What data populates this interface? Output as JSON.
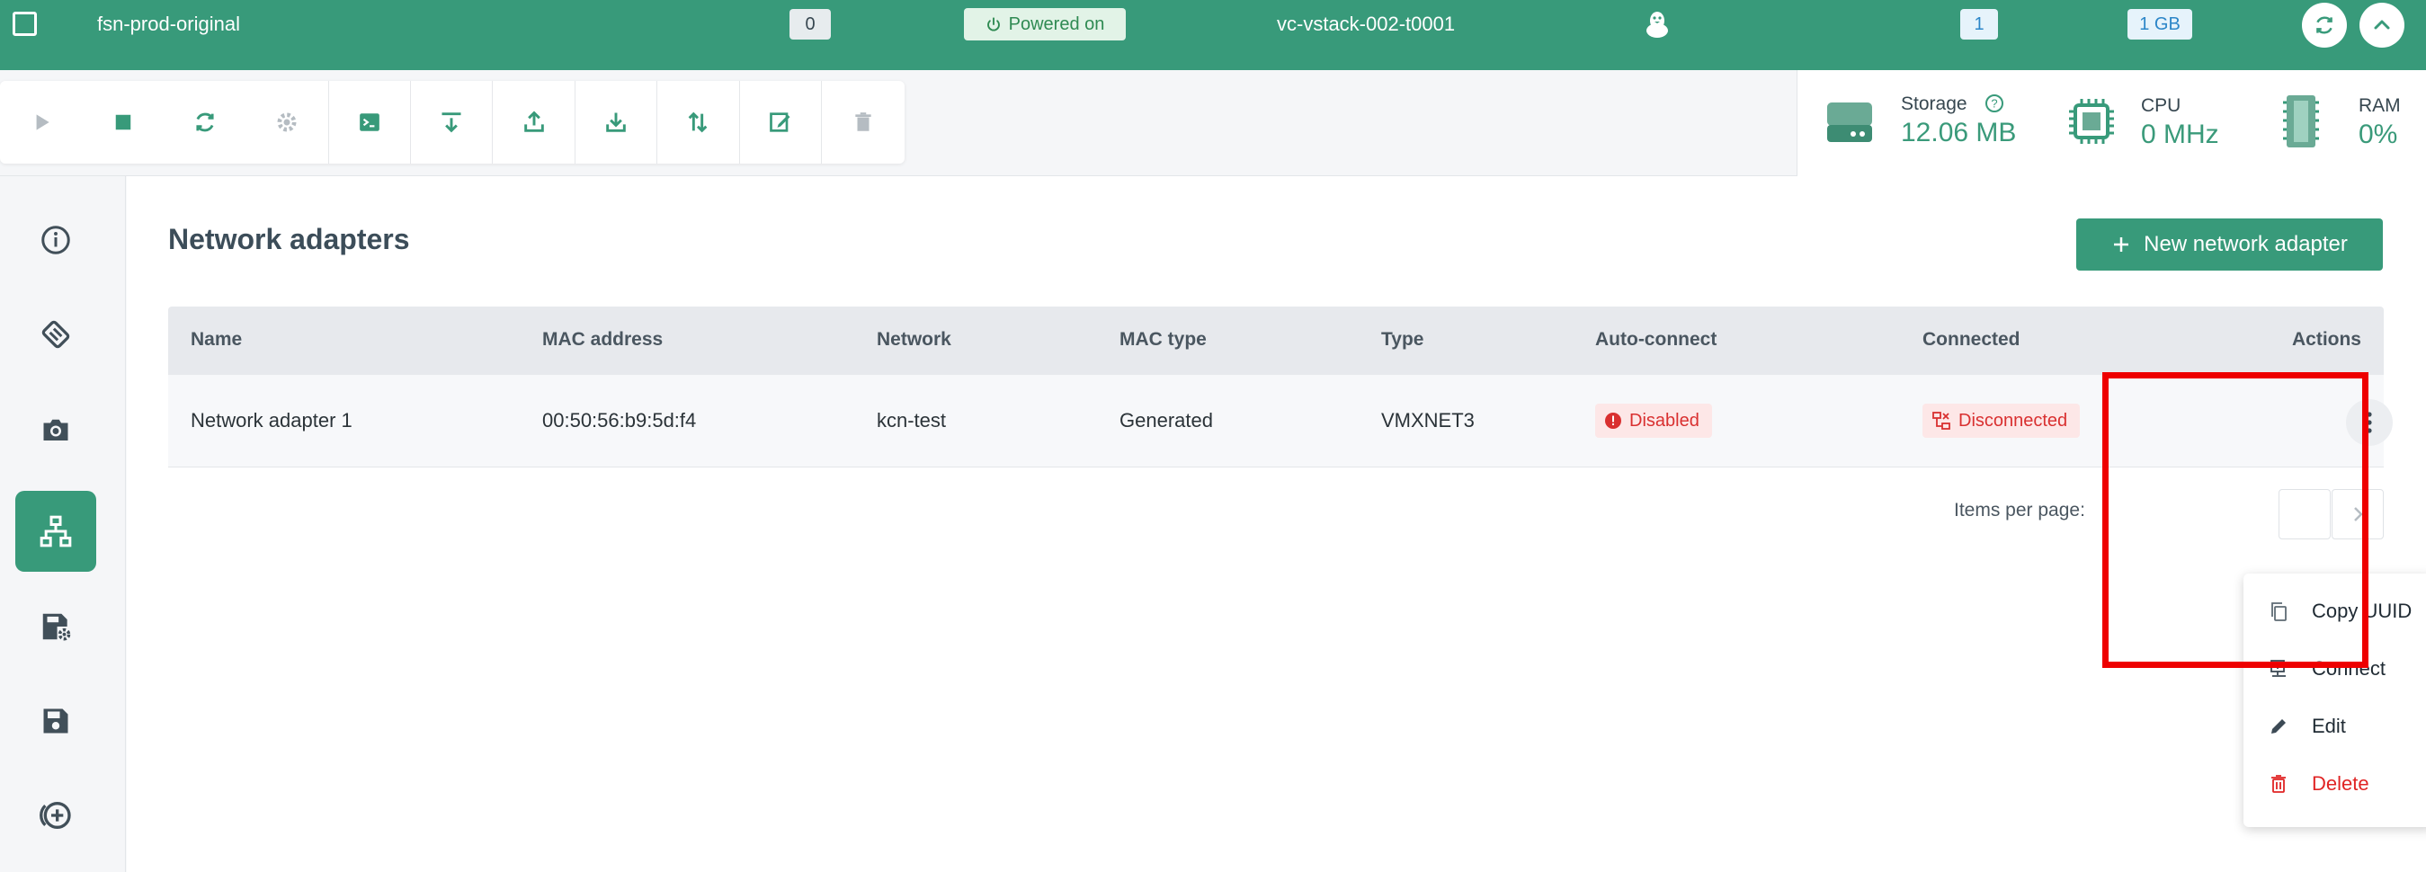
{
  "topbar": {
    "vm_name": "fsn-prod-original",
    "count": "0",
    "power_status": "Powered on",
    "host": "vc-vstack-002-t0001",
    "cpu_count": "1",
    "ram": "1 GB"
  },
  "toolbar": {
    "icons": [
      "play-icon",
      "stop-icon",
      "restart-icon",
      "settings-icon",
      "console-icon",
      "download-into-icon",
      "upload-icon",
      "download-icon",
      "transfer-icon",
      "edit-icon",
      "delete-icon"
    ]
  },
  "stats": {
    "storage_label": "Storage",
    "storage_value": "12.06 MB",
    "cpu_label": "CPU",
    "cpu_value": "0 MHz",
    "ram_label": "RAM",
    "ram_value": "0%"
  },
  "sidebar": {
    "items": [
      "info-icon",
      "disk-icon",
      "camera-icon",
      "network-icon",
      "storage-settings-icon",
      "save-icon",
      "add-circle-icon"
    ],
    "active_index": 3
  },
  "main": {
    "title": "Network adapters",
    "new_button": "New network adapter",
    "columns": [
      "Name",
      "MAC address",
      "Network",
      "MAC type",
      "Type",
      "Auto-connect",
      "Connected",
      "Actions"
    ],
    "rows": [
      {
        "name": "Network adapter 1",
        "mac": "00:50:56:b9:5d:f4",
        "network": "kcn-test",
        "mac_type": "Generated",
        "type": "VMXNET3",
        "auto_connect": "Disabled",
        "connected": "Disconnected"
      }
    ],
    "pager_label": "Items per page:"
  },
  "menu": {
    "items": [
      {
        "label": "Copy UUID",
        "icon": "copy-icon"
      },
      {
        "label": "Connect",
        "icon": "connect-icon"
      },
      {
        "label": "Edit",
        "icon": "pencil-icon"
      },
      {
        "label": "Delete",
        "icon": "trash-icon",
        "danger": true
      }
    ]
  },
  "colors": {
    "accent": "#389a7a",
    "danger": "#e02424",
    "highlight": "#ee0000"
  }
}
